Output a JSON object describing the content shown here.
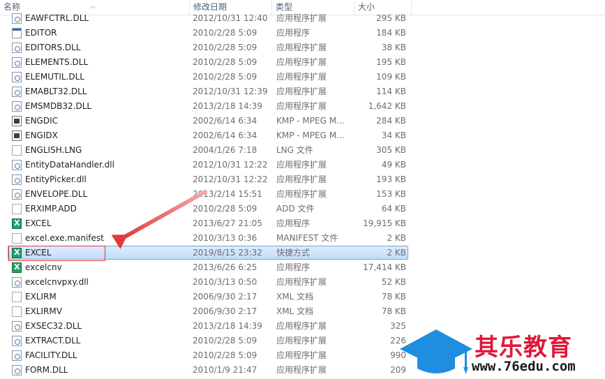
{
  "columns": {
    "name": "名称",
    "date": "修改日期",
    "type": "类型",
    "size": "大小"
  },
  "files": [
    {
      "name": "EAWFCTRL.DLL",
      "date": "2012/10/31 12:40",
      "type": "应用程序扩展",
      "size": "295 KB",
      "icon": "dll-icon"
    },
    {
      "name": "EDITOR",
      "date": "2010/2/28 5:09",
      "type": "应用程序",
      "size": "184 KB",
      "icon": "application-icon"
    },
    {
      "name": "EDITORS.DLL",
      "date": "2010/2/28 5:09",
      "type": "应用程序扩展",
      "size": "38 KB",
      "icon": "dll-icon"
    },
    {
      "name": "ELEMENTS.DLL",
      "date": "2010/2/28 5:09",
      "type": "应用程序扩展",
      "size": "195 KB",
      "icon": "dll-icon"
    },
    {
      "name": "ELEMUTIL.DLL",
      "date": "2010/2/28 5:09",
      "type": "应用程序扩展",
      "size": "109 KB",
      "icon": "dll-icon"
    },
    {
      "name": "EMABLT32.DLL",
      "date": "2012/10/31 12:39",
      "type": "应用程序扩展",
      "size": "114 KB",
      "icon": "dll-icon"
    },
    {
      "name": "EMSMDB32.DLL",
      "date": "2013/2/18 14:39",
      "type": "应用程序扩展",
      "size": "1,642 KB",
      "icon": "dll-icon"
    },
    {
      "name": "ENGDIC",
      "date": "2002/6/14 6:34",
      "type": "KMP - MPEG M...",
      "size": "284 KB",
      "icon": "media-icon"
    },
    {
      "name": "ENGIDX",
      "date": "2002/6/14 6:34",
      "type": "KMP - MPEG M...",
      "size": "34 KB",
      "icon": "media-icon"
    },
    {
      "name": "ENGLISH.LNG",
      "date": "2004/1/26 7:18",
      "type": "LNG 文件",
      "size": "305 KB",
      "icon": "file-icon"
    },
    {
      "name": "EntityDataHandler.dll",
      "date": "2012/10/31 12:22",
      "type": "应用程序扩展",
      "size": "49 KB",
      "icon": "dll-icon"
    },
    {
      "name": "EntityPicker.dll",
      "date": "2012/10/31 12:22",
      "type": "应用程序扩展",
      "size": "193 KB",
      "icon": "dll-icon"
    },
    {
      "name": "ENVELOPE.DLL",
      "date": "2013/2/14 15:51",
      "type": "应用程序扩展",
      "size": "153 KB",
      "icon": "dll-icon"
    },
    {
      "name": "ERXIMP.ADD",
      "date": "2010/2/28 5:09",
      "type": "ADD 文件",
      "size": "64 KB",
      "icon": "file-icon"
    },
    {
      "name": "EXCEL",
      "date": "2013/6/27 21:05",
      "type": "应用程序",
      "size": "19,915 KB",
      "icon": "excel-icon"
    },
    {
      "name": "excel.exe.manifest",
      "date": "2010/3/13 0:36",
      "type": "MANIFEST 文件",
      "size": "2 KB",
      "icon": "file-icon"
    },
    {
      "name": "EXCEL",
      "date": "2019/8/15 23:32",
      "type": "快捷方式",
      "size": "2 KB",
      "icon": "excel-shortcut-icon",
      "selected": true
    },
    {
      "name": "excelcnv",
      "date": "2013/6/26 6:25",
      "type": "应用程序",
      "size": "17,414 KB",
      "icon": "excel-icon"
    },
    {
      "name": "excelcnvpxy.dll",
      "date": "2010/3/13 0:50",
      "type": "应用程序扩展",
      "size": "52 KB",
      "icon": "dll-icon"
    },
    {
      "name": "EXLIRM",
      "date": "2006/9/30 2:17",
      "type": "XML 文档",
      "size": "78 KB",
      "icon": "file-icon"
    },
    {
      "name": "EXLIRMV",
      "date": "2006/9/30 2:17",
      "type": "XML 文档",
      "size": "78 KB",
      "icon": "file-icon"
    },
    {
      "name": "EXSEC32.DLL",
      "date": "2013/2/18 14:39",
      "type": "应用程序扩展",
      "size": "325",
      "icon": "dll-icon"
    },
    {
      "name": "EXTRACT.DLL",
      "date": "2010/2/28 5:09",
      "type": "应用程序扩展",
      "size": "226",
      "icon": "dll-icon"
    },
    {
      "name": "FACILITY.DLL",
      "date": "2010/2/28 5:09",
      "type": "应用程序扩展",
      "size": "990",
      "icon": "dll-icon"
    },
    {
      "name": "FORM.DLL",
      "date": "2010/1/9 21:47",
      "type": "应用程序扩展",
      "size": "209",
      "icon": "dll-icon"
    }
  ],
  "watermark": {
    "name": "其乐教育",
    "url": "www.76edu.com"
  },
  "colors": {
    "selection": "#cce4fc",
    "annotation": "#e03a3a",
    "watermark_red": "#e0183a",
    "watermark_blue": "#1f8ee0"
  }
}
